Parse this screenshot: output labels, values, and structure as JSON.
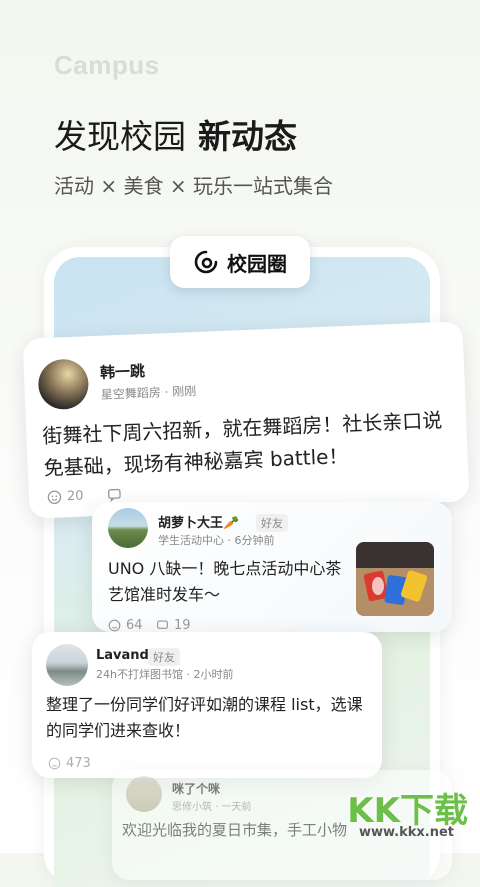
{
  "brand": "Campus",
  "headline": {
    "part1": "发现校园",
    "part2": "新动态"
  },
  "subtitle": "活动 × 美食 × 玩乐一站式集合",
  "tab_pill": {
    "label": "校园圈",
    "icon": "campus-circle-icon"
  },
  "posts": [
    {
      "name": "韩一跳",
      "meta": "星空舞蹈房 · 刚刚",
      "text": "街舞社下周六招新，就在舞蹈房！社长亲口说免基础，现场有神秘嘉宾 battle！",
      "likes": "20"
    },
    {
      "name": "胡萝卜大王🥕",
      "tag": "好友",
      "meta": "学生活动中心 · 6分钟前",
      "text": "UNO 八缺一！晚七点活动中心茶艺馆准时发车～",
      "likes": "64",
      "comments": "19"
    },
    {
      "name": "Lavande",
      "tag": "好友",
      "meta": "24h不打烊图书馆 · 2小时前",
      "text": "整理了一份同学们好评如潮的课程 list，选课的同学们进来查收！",
      "likes": "473"
    },
    {
      "name": "咪了个咪",
      "meta": "思修小筑 · 一天前",
      "text": "欢迎光临我的夏日市集，手工小物"
    }
  ],
  "watermark": {
    "main": "KK下载",
    "url": "www.kkx.net"
  },
  "colors": {
    "watermark_green": "#6cc04a",
    "brand_gray": "#d8ddd6"
  }
}
